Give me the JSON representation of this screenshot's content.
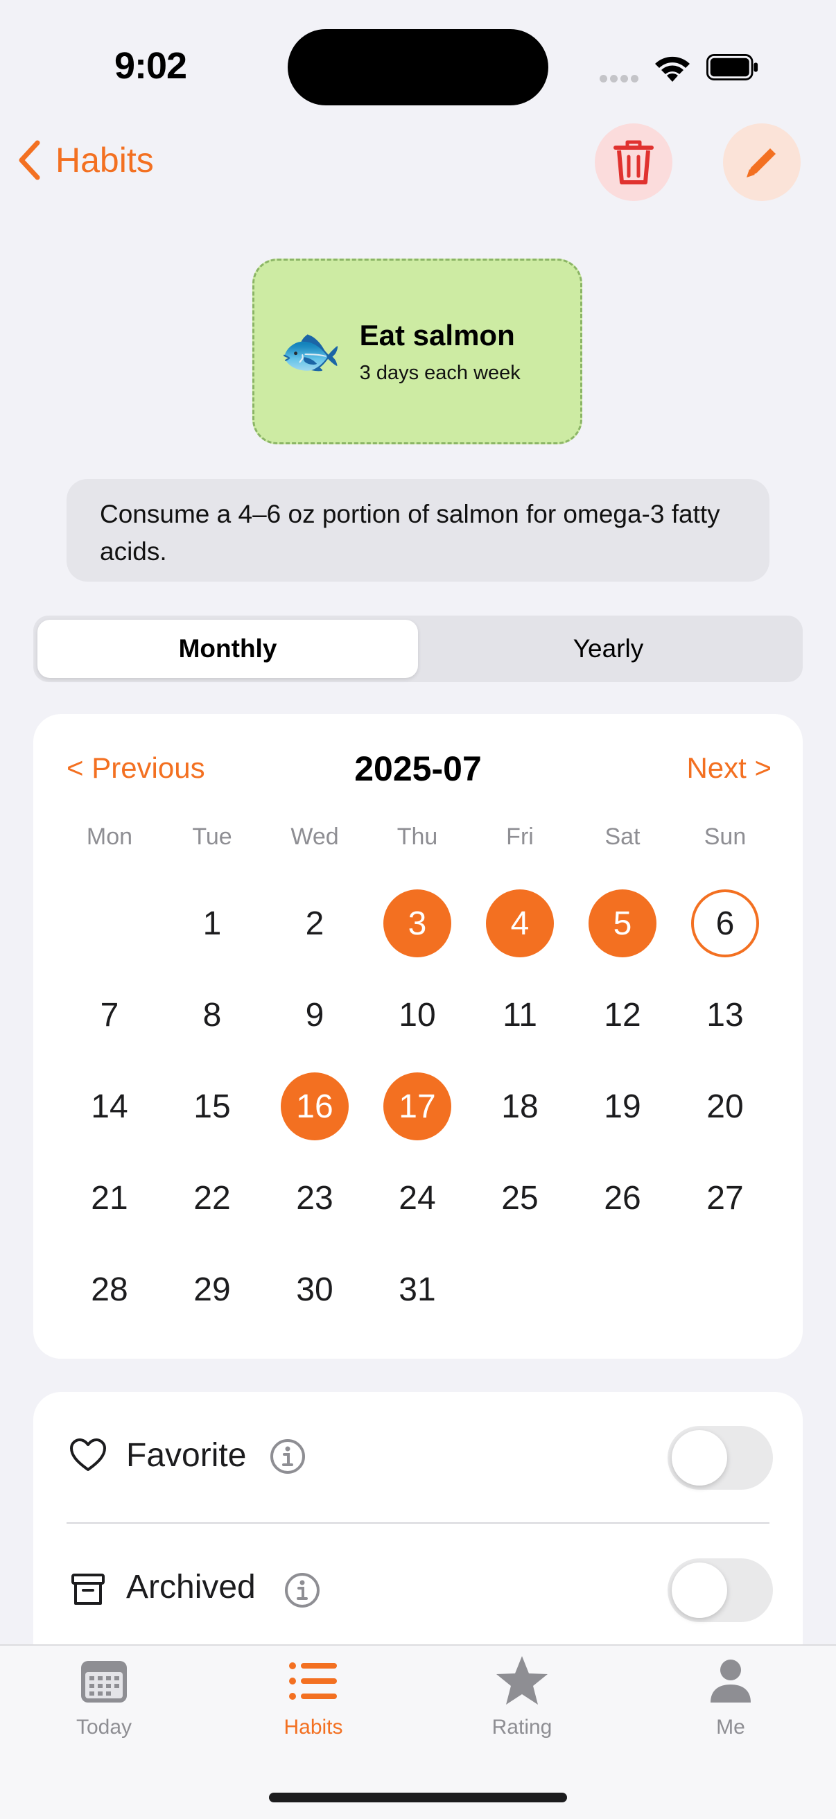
{
  "status_bar": {
    "time": "9:02"
  },
  "nav": {
    "back_label": "Habits"
  },
  "habit": {
    "emoji": "🐟",
    "name": "Eat salmon",
    "frequency": "3 days each week",
    "description": "Consume a 4–6 oz portion of salmon for omega-3 fatty acids.",
    "card_color": "#cdeba3"
  },
  "segment": {
    "options": [
      "Monthly",
      "Yearly"
    ],
    "selected": "Monthly"
  },
  "calendar": {
    "prev_label": "< Previous",
    "next_label": "Next >",
    "month": "2025-07",
    "weekdays": [
      "Mon",
      "Tue",
      "Wed",
      "Thu",
      "Fri",
      "Sat",
      "Sun"
    ],
    "first_weekday_index": 1,
    "days_in_month": 31,
    "completed_days": [
      3,
      4,
      5,
      16,
      17
    ],
    "today": 6
  },
  "settings": {
    "favorite_label": "Favorite",
    "favorite_on": false,
    "archived_label": "Archived",
    "archived_on": false
  },
  "tabbar": {
    "items": [
      "Today",
      "Habits",
      "Rating",
      "Me"
    ],
    "selected": "Habits"
  },
  "colors": {
    "accent": "#f37021",
    "delete": "#e0322f"
  }
}
